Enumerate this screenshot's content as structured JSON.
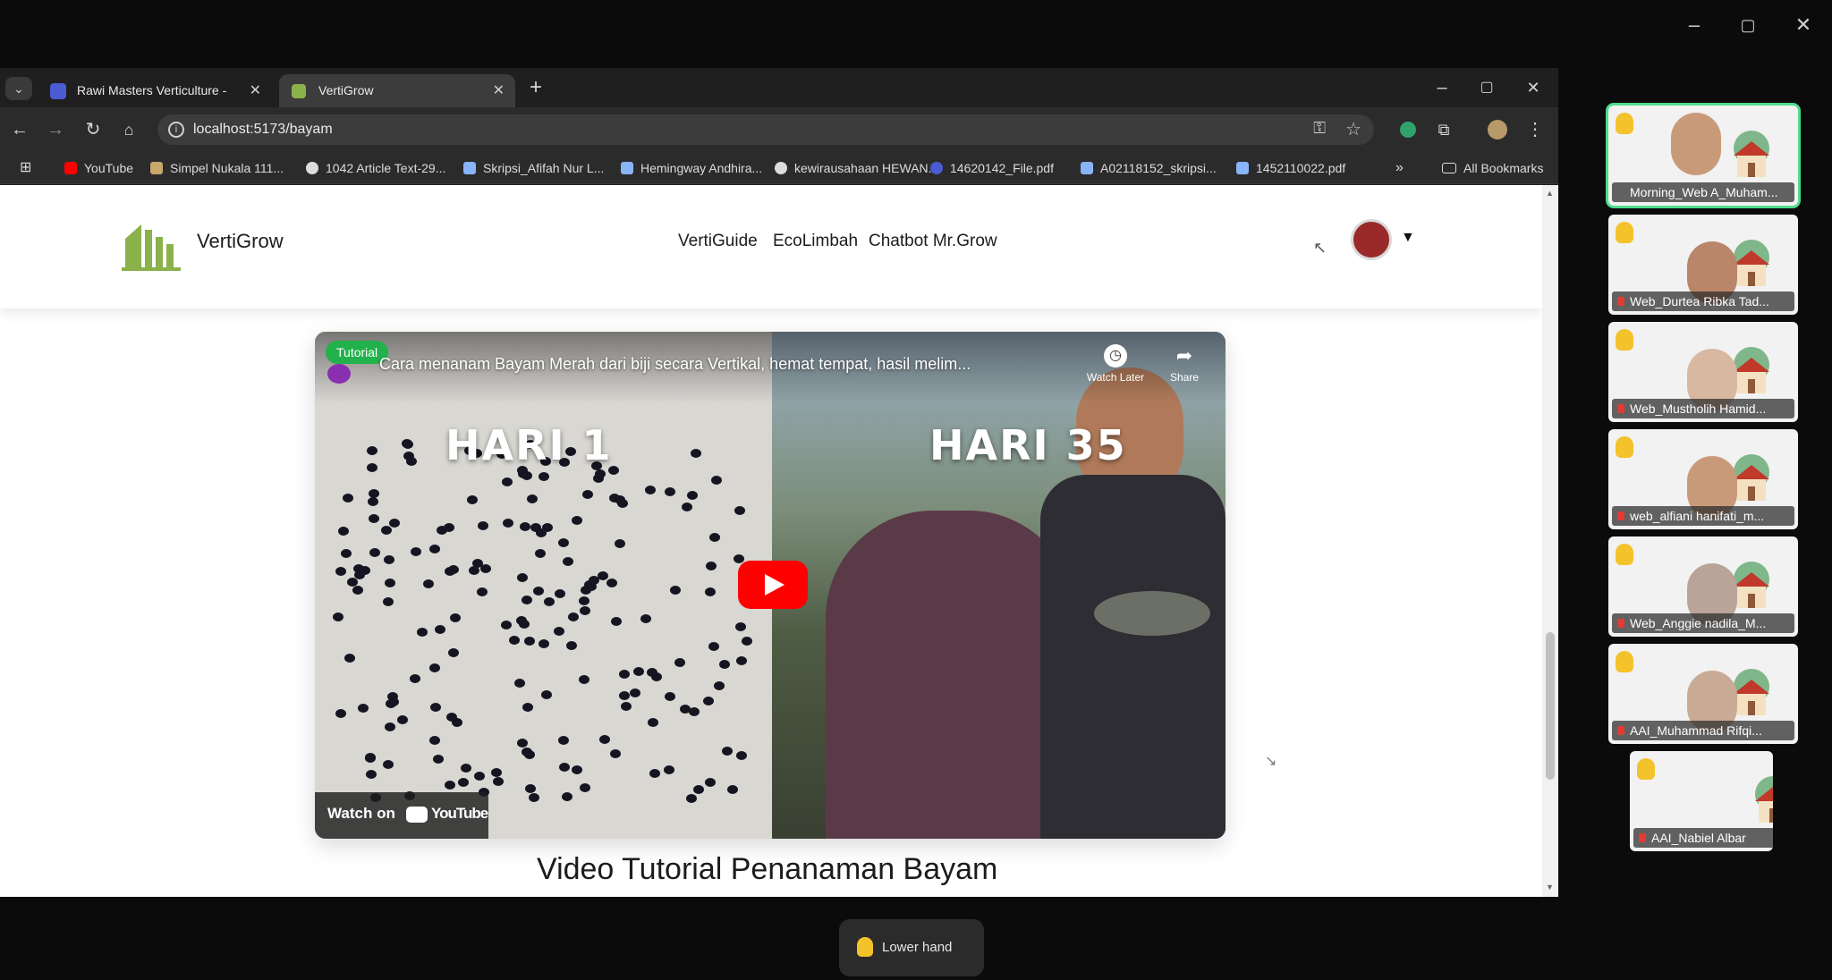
{
  "meeting": {
    "window_controls": {
      "minimize": "–",
      "maximize": "▢",
      "close": "✕"
    },
    "lower_hand_label": "Lower hand",
    "participants": [
      {
        "name": "Morning_Web A_Muham...",
        "active": true
      },
      {
        "name": "Web_Durtea Ribka Tad..."
      },
      {
        "name": "Web_Mustholih Hamid..."
      },
      {
        "name": "web_alfiani hanifati_m..."
      },
      {
        "name": "Web_Anggie nadila_M..."
      },
      {
        "name": "AAI_Muhammad Rifqi..."
      },
      {
        "name": "AAI_Nabiel Albar"
      }
    ]
  },
  "browser": {
    "tabs": [
      {
        "title": "Rawi Masters Verticulture - Pr...",
        "active": false
      },
      {
        "title": "VertiGrow",
        "active": true
      }
    ],
    "new_tab": "+",
    "window_controls": {
      "minimize": "–",
      "maximize": "▢",
      "close": "✕"
    },
    "url": "localhost:5173/bayam",
    "bookmarks": [
      "YouTube",
      "Simpel Nukala 111...",
      "1042 Article Text-29...",
      "Skripsi_Afifah Nur L...",
      "Hemingway Andhira...",
      "kewirausahaan HEWAN...",
      "14620142_File.pdf",
      "A02118152_skripsi...",
      "1452110022.pdf"
    ],
    "bookmarks_overflow": "»",
    "all_bookmarks": "All Bookmarks"
  },
  "site": {
    "brand": "VertiGrow",
    "nav": [
      "VertiGuide",
      "EcoLimbah",
      "Chatbot Mr.Grow"
    ],
    "avatar_caret": "▼",
    "video": {
      "badge": "Tutorial",
      "title": "Cara menanam Bayam Merah dari biji secara Vertikal, hemat tempat, hasil melim...",
      "watch_later": "Watch Later",
      "share": "Share",
      "left_label": "HARI 1",
      "right_label": "HARI 35",
      "watch_on": "Watch on",
      "youtube": "YouTube"
    },
    "section_heading": "Video Tutorial Penanaman Bayam"
  },
  "colors": {
    "brand_green": "#8bb24a",
    "youtube_red": "#ff0000",
    "tutorial_badge": "#22b14c",
    "active_speaker": "#4ddc8a"
  }
}
